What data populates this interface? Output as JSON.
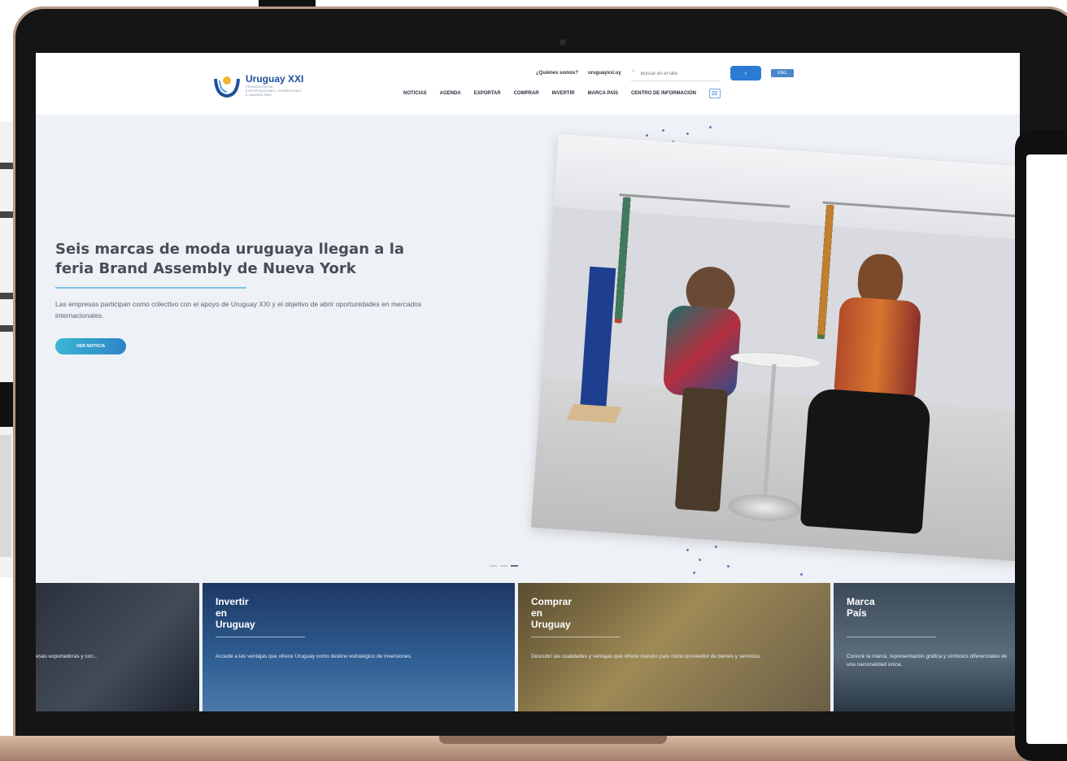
{
  "header": {
    "logo_name": "Uruguay XXI",
    "logo_tagline": "PROMOCIÓN DE EXPORTACIONES, INVERSIONES E IMAGEN PAÍS",
    "utility_links": [
      "¿Quiénes somos?",
      "uruguayxxi.uy"
    ],
    "search_placeholder": "Buscar en el sitio",
    "search_button": "›",
    "language": "ENG",
    "nav": [
      "NOTICIAS",
      "AGENDA",
      "EXPORTAR",
      "COMPRAR",
      "INVERTIR",
      "MARCA PAÍS",
      "CENTRO DE INFORMACIÓN"
    ]
  },
  "hero": {
    "title": "Seis marcas de moda uruguaya llegan a la feria Brand Assembly de Nueva York",
    "description": "Las empresas participan como colectivo con el apoyo de Uruguay XXI y el objetivo de abrir oportunidades en mercados internacionales.",
    "button": "VER NOTICIA",
    "image_alt": "Two women seated at a round table in front of clothing racks at a fashion fair",
    "pager_active_index": 2,
    "pager_count": 3
  },
  "cards": [
    {
      "title": "",
      "description": "...s para empresas exportadoras y con..."
    },
    {
      "title": "Invertir\nen\nUruguay",
      "description": "Accedé a las ventajas que ofrece Uruguay como destino estratégico de inversiones."
    },
    {
      "title": "Comprar\nen\nUruguay",
      "description": "Descubrí las cualidades y ventajas que ofrece nuestro país como proveedor de bienes y servicios."
    },
    {
      "title": "Marca\nPaís",
      "description": "Conocé la marca, representación gráfica y símbolos diferenciales de una nacionalidad única."
    }
  ],
  "colors": {
    "accent_blue": "#2b7bd3",
    "hero_bg": "#eef1f6",
    "title_color": "#4a4d57",
    "button_gradient_start": "#3ab7d2",
    "button_gradient_end": "#2d84c9"
  }
}
